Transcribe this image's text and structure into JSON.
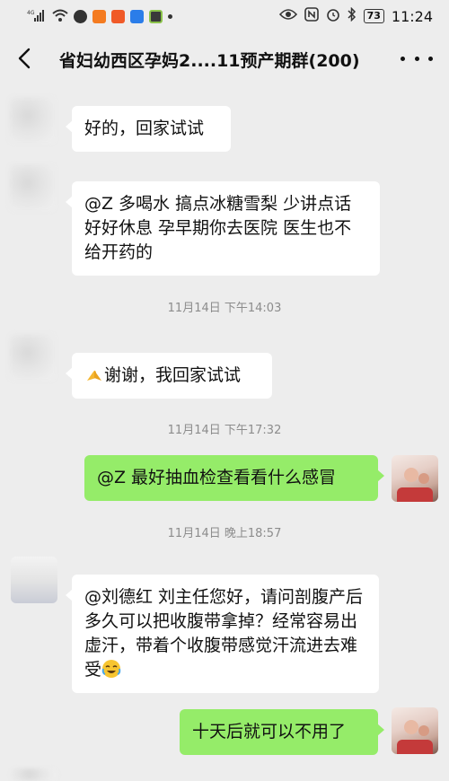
{
  "status_bar": {
    "signal_label": "4G",
    "battery": "73",
    "time": "11:24"
  },
  "header": {
    "title": "省妇幼西区孕妈2....11预产期群(200)"
  },
  "messages": [
    {
      "side": "left",
      "text": "好的，回家试试"
    },
    {
      "side": "left",
      "text": "@Z  多喝水 搞点冰糖雪梨 少讲点话 好好休息 孕早期你去医院 医生也不给开药的"
    },
    {
      "side": "left",
      "text": "谢谢，我回家试试"
    },
    {
      "side": "right",
      "text": "@Z  最好抽血检查看看什么感冒"
    },
    {
      "side": "left",
      "text": "@刘德红  刘主任您好，请问剖腹产后多久可以把收腹带拿掉？经常容易出虚汗，带着个收腹带感觉汗流进去难受"
    },
    {
      "side": "right",
      "text": "十天后就可以不用了"
    }
  ],
  "timestamps": [
    "11月14日 下午14:03",
    "11月14日 下午17:32",
    "11月14日 晚上18:57"
  ],
  "colors": {
    "background": "#ededed",
    "bubble_left": "#ffffff",
    "bubble_right": "#95ec69"
  }
}
